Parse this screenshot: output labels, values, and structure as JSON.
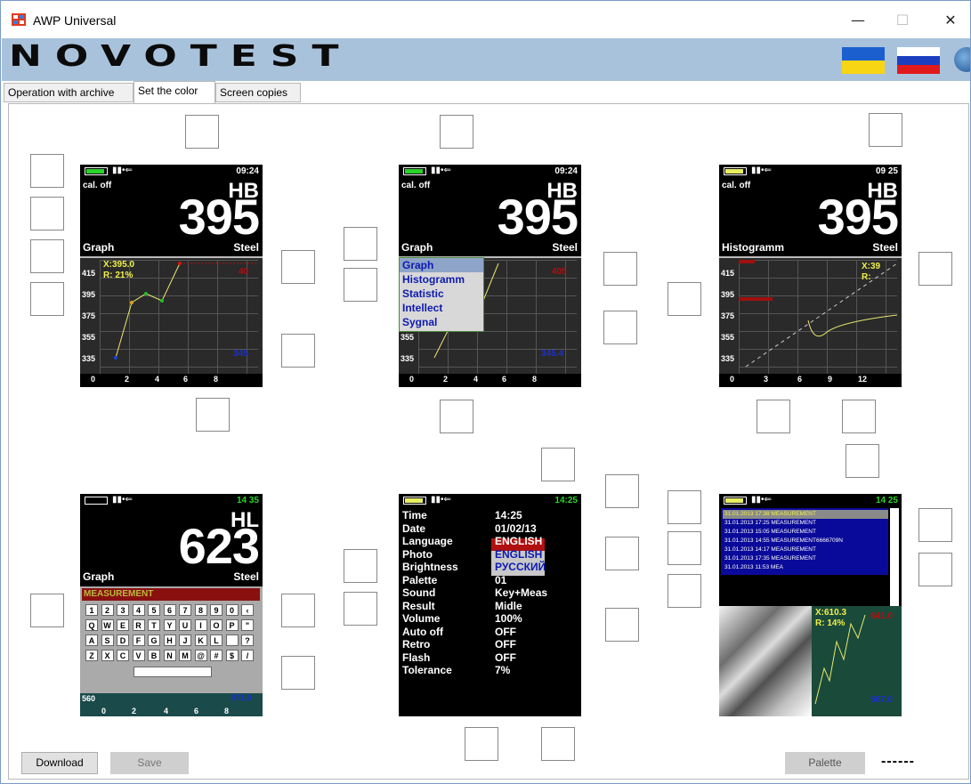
{
  "window": {
    "title": "AWP Universal",
    "minimize": "—",
    "maximize": "☐",
    "close": "✕"
  },
  "brand": {
    "logo_text": "NOVOTEST"
  },
  "tabs": [
    {
      "label": "Operation with archive"
    },
    {
      "label": "Set the color"
    },
    {
      "label": "Screen copies"
    }
  ],
  "active_tab": 1,
  "screen1": {
    "time": "09:24",
    "cal": "cal. off",
    "unit": "HB",
    "value": "395",
    "mode": "Graph",
    "material": "Steel",
    "readout_x": "X:395.0",
    "readout_r": "R: 21%",
    "y_ticks": [
      "415",
      "395",
      "375",
      "355",
      "335"
    ],
    "x_ticks": [
      "0",
      "2",
      "4",
      "6",
      "8"
    ],
    "max_label": "40",
    "min_label": "345"
  },
  "screen2": {
    "time": "09:24",
    "cal": "cal. off",
    "unit": "HB",
    "value": "395",
    "mode": "Graph",
    "material": "Steel",
    "menu": [
      "Graph",
      "Histogramm",
      "Statistic",
      "Intellect",
      "Sygnal"
    ],
    "y_ticks": [
      "415",
      "395",
      "375",
      "355",
      "335"
    ],
    "x_ticks": [
      "0",
      "2",
      "4",
      "6",
      "8"
    ],
    "max_label": "405",
    "min_label": "345.4"
  },
  "screen3": {
    "time": "09 25",
    "cal": "cal. off",
    "unit": "HB",
    "value": "395",
    "mode": "Histogramm",
    "material": "Steel",
    "readout_x": "X:39",
    "readout_r": "R:",
    "y_ticks": [
      "415",
      "395",
      "375",
      "355",
      "335"
    ],
    "x_ticks": [
      "0",
      "3",
      "6",
      "9",
      "12"
    ]
  },
  "screen4": {
    "time": "14 35",
    "unit": "HL",
    "value": "623",
    "mode": "Graph",
    "material": "Steel",
    "input": "MEASUREMENT",
    "keys_row1": [
      "1",
      "2",
      "3",
      "4",
      "5",
      "6",
      "7",
      "8",
      "9",
      "0",
      "‹"
    ],
    "keys_row2": [
      "Q",
      "W",
      "E",
      "R",
      "T",
      "Y",
      "U",
      "I",
      "O",
      "P",
      "\""
    ],
    "keys_row3": [
      "A",
      "S",
      "D",
      "F",
      "G",
      "H",
      "J",
      "K",
      "L",
      "",
      "?"
    ],
    "keys_row4": [
      "Z",
      "X",
      "C",
      "V",
      "B",
      "N",
      "M",
      "@",
      "#",
      "$",
      "/"
    ],
    "y_tick": "560",
    "x_ticks": [
      "0",
      "2",
      "4",
      "6",
      "8"
    ],
    "side_value": "571.0"
  },
  "screen5": {
    "time": "14:25",
    "settings": [
      {
        "label": "Time",
        "value": "14:25"
      },
      {
        "label": "Date",
        "value": "01/02/13"
      },
      {
        "label": "Language",
        "value": "ENGLISH"
      },
      {
        "label": "Photo",
        "value": "ENGLISH"
      },
      {
        "label": "Brightness",
        "value": "РУССКИЙ"
      },
      {
        "label": "Palette",
        "value": "01"
      },
      {
        "label": "Sound",
        "value": "Key+Meas"
      },
      {
        "label": "Result",
        "value": "Midle"
      },
      {
        "label": "Volume",
        "value": "100%"
      },
      {
        "label": "Auto off",
        "value": "OFF"
      },
      {
        "label": "Retro",
        "value": "OFF"
      },
      {
        "label": "Flash",
        "value": "OFF"
      },
      {
        "label": "Tolerance",
        "value": "7%"
      }
    ]
  },
  "screen6": {
    "time": "14 25",
    "archive": [
      "31.01.2013 17:38 MEASUREMENT",
      "31.01.2013 17:25 MEASUREMENT",
      "31.01.2013 15:05 MEASUREMENT",
      "31.01.2013 14:55 MEASUREMENT6666709N",
      "31.01.2013 14:17 MEASUREMENT",
      "31.01.2013 17:35 MEASUREMENT",
      "31.01.2013 11:53 MEA"
    ],
    "readout_x": "X:610.3",
    "readout_r": "R: 14%",
    "max_label": "641.0",
    "min_label": "567.0"
  },
  "buttons": {
    "download": "Download",
    "save": "Save",
    "palette": "Palette",
    "status": "------"
  },
  "colors": {
    "window_border": "#7a9cc8",
    "brand_bar": "#a9c2dc",
    "callout_line": "#e01010",
    "menu_text": "#0d1ab0",
    "archive_bg": "#0a0a9a"
  }
}
